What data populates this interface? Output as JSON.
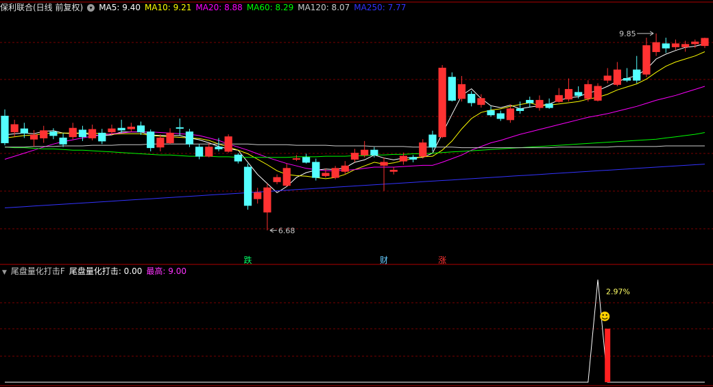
{
  "header": {
    "title": "保利联合(日线 前复权)",
    "ma": [
      {
        "label": "MA5: 9.40",
        "color": "#ffffff"
      },
      {
        "label": "MA10: 9.21",
        "color": "#ffff00"
      },
      {
        "label": "MA20: 8.88",
        "color": "#ff00ff"
      },
      {
        "label": "MA60: 8.29",
        "color": "#00ff00"
      },
      {
        "label": "MA120: 8.07",
        "color": "#cccccc"
      },
      {
        "label": "MA250: 7.77",
        "color": "#3333ff"
      }
    ]
  },
  "indicator_header": {
    "name": "尾盘量化打击F",
    "value_label": "尾盘量化打击: 0.00",
    "max_label": "最高: 9.00",
    "max_color": "#ff33ff"
  },
  "markers": [
    {
      "text": "跌",
      "color": "#00ff66"
    },
    {
      "text": "财",
      "color": "#66ccff"
    },
    {
      "text": "涨",
      "color": "#ff3333"
    }
  ],
  "colors": {
    "up": "#ff3232",
    "down": "#54ffff",
    "grid": "#7a0000"
  },
  "chart_data": [
    {
      "type": "candlestick",
      "ylim": [
        6.3,
        10.2
      ],
      "high_label": "9.85",
      "low_label": "6.68",
      "candles": [
        [
          8.56,
          8.12,
          8.67,
          8.08
        ],
        [
          8.3,
          8.42,
          8.5,
          8.22
        ],
        [
          8.35,
          8.28,
          8.45,
          8.2
        ],
        [
          8.18,
          8.25,
          8.33,
          8.06
        ],
        [
          8.2,
          8.32,
          8.4,
          8.12
        ],
        [
          8.3,
          8.24,
          8.36,
          8.18
        ],
        [
          8.2,
          8.1,
          8.28,
          8.05
        ],
        [
          8.22,
          8.36,
          8.45,
          8.18
        ],
        [
          8.33,
          8.22,
          8.4,
          8.15
        ],
        [
          8.2,
          8.34,
          8.42,
          8.16
        ],
        [
          8.28,
          8.15,
          8.35,
          8.1
        ],
        [
          8.3,
          8.35,
          8.42,
          8.25
        ],
        [
          8.36,
          8.33,
          8.5,
          8.28
        ],
        [
          8.35,
          8.38,
          8.45,
          8.3
        ],
        [
          8.4,
          8.3,
          8.47,
          8.25
        ],
        [
          8.3,
          8.04,
          8.34,
          7.98
        ],
        [
          8.05,
          8.2,
          8.26,
          7.98
        ],
        [
          8.12,
          8.28,
          8.36,
          8.1
        ],
        [
          8.37,
          8.36,
          8.52,
          8.24
        ],
        [
          8.3,
          8.1,
          8.35,
          8.05
        ],
        [
          8.05,
          7.9,
          8.1,
          7.85
        ],
        [
          7.9,
          8.05,
          8.12,
          7.88
        ],
        [
          8.05,
          8.02,
          8.2,
          7.98
        ],
        [
          7.98,
          8.22,
          8.26,
          7.96
        ],
        [
          7.92,
          7.82,
          7.95,
          7.78
        ],
        [
          7.72,
          7.09,
          7.78,
          7.02
        ],
        [
          7.2,
          7.3,
          7.38,
          7.12
        ],
        [
          6.98,
          7.38,
          7.45,
          6.68
        ],
        [
          7.48,
          7.55,
          7.6,
          7.44
        ],
        [
          7.42,
          7.7,
          7.78,
          7.4
        ],
        [
          7.85,
          7.86,
          7.92,
          7.82
        ],
        [
          7.88,
          7.8,
          7.94,
          7.78
        ],
        [
          7.8,
          7.55,
          7.86,
          7.5
        ],
        [
          7.58,
          7.62,
          7.7,
          7.55
        ],
        [
          7.55,
          7.7,
          7.74,
          7.52
        ],
        [
          7.65,
          7.74,
          7.82,
          7.6
        ],
        [
          7.85,
          7.95,
          8.02,
          7.8
        ],
        [
          7.92,
          8.0,
          8.15,
          7.88
        ],
        [
          8.0,
          7.92,
          8.05,
          7.88
        ],
        [
          7.75,
          7.8,
          7.88,
          7.33
        ],
        [
          7.65,
          7.67,
          7.72,
          7.6
        ],
        [
          7.82,
          7.9,
          7.96,
          7.76
        ],
        [
          7.88,
          7.85,
          7.92,
          7.8
        ],
        [
          7.9,
          8.12,
          8.18,
          7.86
        ],
        [
          8.25,
          8.05,
          8.32,
          7.98
        ],
        [
          8.22,
          9.35,
          9.4,
          8.2
        ],
        [
          9.2,
          8.82,
          9.28,
          8.8
        ],
        [
          8.85,
          9.08,
          9.22,
          8.8
        ],
        [
          8.92,
          8.78,
          8.97,
          8.72
        ],
        [
          8.75,
          8.85,
          8.92,
          8.7
        ],
        [
          8.65,
          8.58,
          8.72,
          8.55
        ],
        [
          8.6,
          8.52,
          8.65,
          8.48
        ],
        [
          8.5,
          8.68,
          8.75,
          8.45
        ],
        [
          8.68,
          8.65,
          8.8,
          8.6
        ],
        [
          8.82,
          8.78,
          8.88,
          8.7
        ],
        [
          8.7,
          8.82,
          8.9,
          8.65
        ],
        [
          8.76,
          8.7,
          8.85,
          8.68
        ],
        [
          8.8,
          8.9,
          9.02,
          8.78
        ],
        [
          8.84,
          9.0,
          9.18,
          8.8
        ],
        [
          8.95,
          8.9,
          9.05,
          8.85
        ],
        [
          8.85,
          9.08,
          9.15,
          8.8
        ],
        [
          8.82,
          9.05,
          9.1,
          8.8
        ],
        [
          9.15,
          9.22,
          9.35,
          9.1
        ],
        [
          9.08,
          9.32,
          9.45,
          9.05
        ],
        [
          9.18,
          9.15,
          9.35,
          9.12
        ],
        [
          9.32,
          9.15,
          9.55,
          9.1
        ],
        [
          9.25,
          9.72,
          9.85,
          9.2
        ],
        [
          9.62,
          9.77,
          9.92,
          9.55
        ],
        [
          9.75,
          9.68,
          9.85,
          9.6
        ],
        [
          9.7,
          9.75,
          9.82,
          9.65
        ],
        [
          9.7,
          9.74,
          9.8,
          9.62
        ],
        [
          9.75,
          9.78,
          9.82,
          9.68
        ],
        [
          9.72,
          9.84,
          9.85,
          9.68
        ]
      ],
      "ma_lines": [
        {
          "name": "MA5",
          "color": "#ffffff",
          "values": [
            8.25,
            8.27,
            8.28,
            8.27,
            8.31,
            8.32,
            8.28,
            8.27,
            8.28,
            8.25,
            8.24,
            8.25,
            8.3,
            8.3,
            8.3,
            8.25,
            8.24,
            8.24,
            8.24,
            8.2,
            8.17,
            8.12,
            8.06,
            8.02,
            8.0,
            7.8,
            7.6,
            7.45,
            7.3,
            7.4,
            7.55,
            7.63,
            7.67,
            7.69,
            7.68,
            7.71,
            7.8,
            7.84,
            7.92,
            7.87,
            7.84,
            7.87,
            7.88,
            7.88,
            7.95,
            8.27,
            8.59,
            8.9,
            9.01,
            8.85,
            8.73,
            8.7,
            8.74,
            8.68,
            8.71,
            8.73,
            8.76,
            8.82,
            8.86,
            8.88,
            8.94,
            8.98,
            9.05,
            9.13,
            9.18,
            9.23,
            9.33,
            9.5,
            9.58,
            9.64,
            9.69,
            9.71,
            9.75
          ]
        },
        {
          "name": "MA10",
          "color": "#ffff00",
          "values": [
            8.2,
            8.22,
            8.24,
            8.25,
            8.27,
            8.28,
            8.28,
            8.28,
            8.28,
            8.28,
            8.27,
            8.26,
            8.27,
            8.27,
            8.27,
            8.24,
            8.23,
            8.22,
            8.21,
            8.2,
            8.19,
            8.16,
            8.1,
            8.05,
            8.0,
            7.94,
            7.85,
            7.76,
            7.66,
            7.6,
            7.58,
            7.57,
            7.55,
            7.53,
            7.55,
            7.6,
            7.68,
            7.74,
            7.8,
            7.77,
            7.79,
            7.83,
            7.86,
            7.89,
            7.9,
            8.0,
            8.15,
            8.35,
            8.52,
            8.62,
            8.66,
            8.68,
            8.72,
            8.75,
            8.78,
            8.73,
            8.74,
            8.76,
            8.78,
            8.8,
            8.84,
            8.87,
            8.92,
            8.99,
            9.04,
            9.09,
            9.17,
            9.28,
            9.38,
            9.45,
            9.5,
            9.55,
            9.62
          ]
        },
        {
          "name": "MA20",
          "color": "#ff00ff",
          "values": [
            7.85,
            7.9,
            7.95,
            8.0,
            8.05,
            8.1,
            8.14,
            8.17,
            8.2,
            8.23,
            8.25,
            8.27,
            8.28,
            8.3,
            8.3,
            8.3,
            8.29,
            8.28,
            8.27,
            8.26,
            8.24,
            8.2,
            8.16,
            8.1,
            8.05,
            8.0,
            7.94,
            7.88,
            7.83,
            7.78,
            7.74,
            7.7,
            7.68,
            7.66,
            7.66,
            7.67,
            7.68,
            7.7,
            7.72,
            7.72,
            7.72,
            7.73,
            7.74,
            7.75,
            7.75,
            7.8,
            7.86,
            7.92,
            8.0,
            8.06,
            8.12,
            8.16,
            8.21,
            8.26,
            8.3,
            8.34,
            8.38,
            8.42,
            8.46,
            8.5,
            8.54,
            8.57,
            8.6,
            8.64,
            8.68,
            8.72,
            8.77,
            8.82,
            8.86,
            8.9,
            8.95,
            9.0,
            9.05
          ]
        },
        {
          "name": "MA60",
          "color": "#00ff00",
          "values": [
            8.05,
            8.04,
            8.04,
            8.03,
            8.02,
            8.02,
            8.01,
            8.0,
            8.0,
            7.99,
            7.98,
            7.97,
            7.96,
            7.95,
            7.94,
            7.93,
            7.92,
            7.92,
            7.91,
            7.9,
            7.9,
            7.9,
            7.89,
            7.89,
            7.88,
            7.88,
            7.88,
            7.88,
            7.88,
            7.88,
            7.89,
            7.89,
            7.89,
            7.9,
            7.9,
            7.9,
            7.91,
            7.91,
            7.92,
            7.92,
            7.93,
            7.93,
            7.94,
            7.94,
            7.95,
            7.96,
            7.97,
            7.98,
            7.99,
            8.0,
            8.01,
            8.02,
            8.03,
            8.04,
            8.05,
            8.06,
            8.07,
            8.08,
            8.09,
            8.1,
            8.11,
            8.12,
            8.13,
            8.14,
            8.15,
            8.16,
            8.17,
            8.18,
            8.2,
            8.22,
            8.24,
            8.26,
            8.29
          ]
        },
        {
          "name": "MA120",
          "color": "#cccccc",
          "values": [
            8.05,
            8.05,
            8.05,
            8.06,
            8.06,
            8.06,
            8.07,
            8.07,
            8.07,
            8.08,
            8.08,
            8.08,
            8.09,
            8.09,
            8.09,
            8.1,
            8.1,
            8.1,
            8.1,
            8.1,
            8.1,
            8.1,
            8.1,
            8.1,
            8.1,
            8.1,
            8.09,
            8.09,
            8.09,
            8.09,
            8.08,
            8.08,
            8.08,
            8.08,
            8.07,
            8.07,
            8.07,
            8.07,
            8.06,
            8.06,
            8.06,
            8.06,
            8.05,
            8.05,
            8.05,
            8.05,
            8.05,
            8.04,
            8.04,
            8.04,
            8.04,
            8.04,
            8.04,
            8.04,
            8.04,
            8.04,
            8.04,
            8.05,
            8.05,
            8.05,
            8.05,
            8.05,
            8.05,
            8.06,
            8.06,
            8.06,
            8.06,
            8.06,
            8.07,
            8.07,
            8.07,
            8.07,
            8.07
          ]
        },
        {
          "name": "MA250",
          "color": "#3333ff",
          "values": [
            7.05,
            7.06,
            7.07,
            7.08,
            7.09,
            7.1,
            7.11,
            7.12,
            7.13,
            7.14,
            7.15,
            7.16,
            7.17,
            7.18,
            7.19,
            7.2,
            7.21,
            7.22,
            7.23,
            7.24,
            7.25,
            7.26,
            7.27,
            7.28,
            7.29,
            7.3,
            7.31,
            7.32,
            7.33,
            7.34,
            7.35,
            7.36,
            7.37,
            7.38,
            7.39,
            7.4,
            7.41,
            7.42,
            7.43,
            7.44,
            7.45,
            7.46,
            7.47,
            7.48,
            7.49,
            7.5,
            7.51,
            7.52,
            7.53,
            7.54,
            7.55,
            7.56,
            7.57,
            7.58,
            7.59,
            7.6,
            7.61,
            7.62,
            7.63,
            7.64,
            7.65,
            7.66,
            7.67,
            7.68,
            7.69,
            7.7,
            7.71,
            7.72,
            7.73,
            7.74,
            7.75,
            7.76,
            7.77
          ]
        }
      ]
    },
    {
      "type": "line",
      "name": "尾盘量化打击",
      "ylim": [
        0,
        9.5
      ],
      "peak_value": 9.0,
      "peak_index": 61,
      "bar_value": 4.7,
      "bar_index": 62,
      "annotation": "2.97%"
    }
  ]
}
